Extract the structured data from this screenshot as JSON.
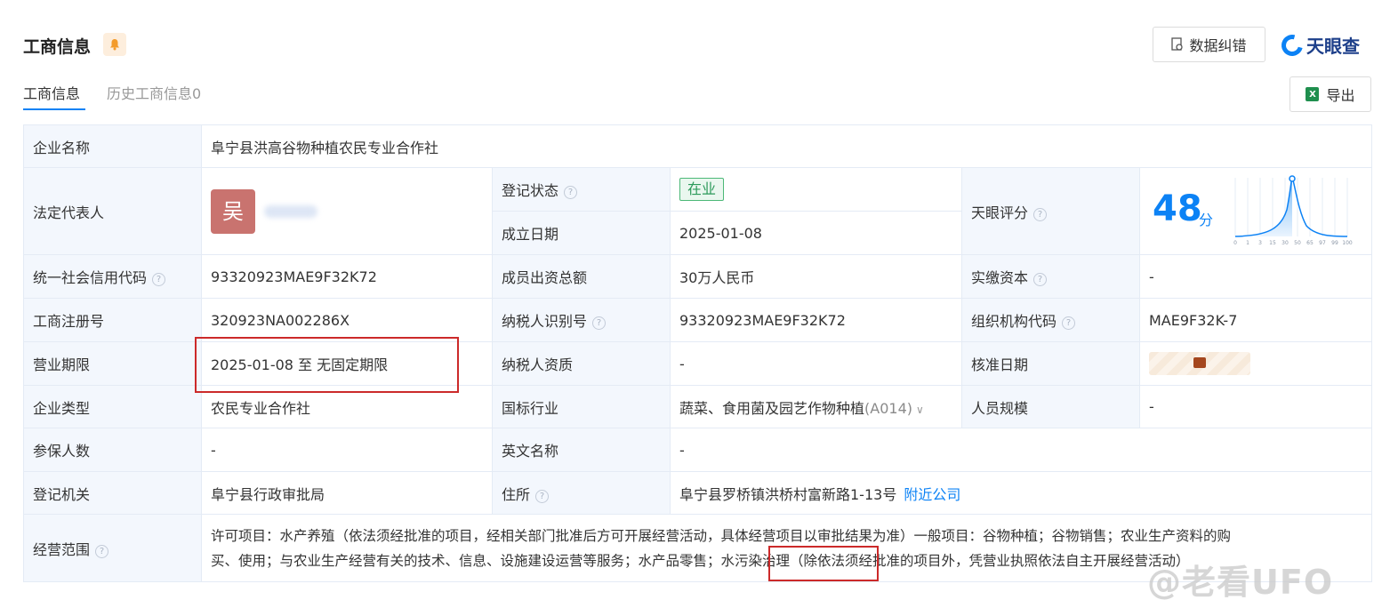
{
  "header": {
    "title": "工商信息",
    "correct_button": "数据纠错",
    "brand": "天眼查",
    "export_button": "导出"
  },
  "tabs": [
    {
      "label": "工商信息"
    },
    {
      "label": "历史工商信息0"
    }
  ],
  "rows": {
    "company_name_label": "企业名称",
    "company_name": "阜宁县洪高谷物种植农民专业合作社",
    "legal_rep_label": "法定代表人",
    "avatar_char": "吴",
    "reg_status_label": "登记状态",
    "reg_status": "在业",
    "founded_label": "成立日期",
    "founded": "2025-01-08",
    "score_label": "天眼评分",
    "score_value": 48,
    "score_unit": "分",
    "credit_code_label": "统一社会信用代码",
    "credit_code": "93320923MAE9F32K72",
    "member_capital_label": "成员出资总额",
    "member_capital": "30万人民币",
    "paid_capital_label": "实缴资本",
    "paid_capital": "-",
    "reg_no_label": "工商注册号",
    "reg_no": "320923NA002286X",
    "taxpayer_id_label": "纳税人识别号",
    "taxpayer_id": "93320923MAE9F32K72",
    "org_code_label": "组织机构代码",
    "org_code": "MAE9F32K-7",
    "term_label": "营业期限",
    "term": "2025-01-08 至 无固定期限",
    "tax_quality_label": "纳税人资质",
    "tax_quality": "-",
    "approval_date_label": "核准日期",
    "company_type_label": "企业类型",
    "company_type": "农民专业合作社",
    "industry_label": "国标行业",
    "industry": "蔬菜、食用菌及园艺作物种植",
    "industry_code": "(A014)",
    "staff_size_label": "人员规模",
    "staff_size": "-",
    "insured_label": "参保人数",
    "insured": "-",
    "english_name_label": "英文名称",
    "english_name": "-",
    "authority_label": "登记机关",
    "authority": "阜宁县行政审批局",
    "address_label": "住所",
    "address": "阜宁县罗桥镇洪桥村富新路1-13号",
    "nearby_link": "附近公司",
    "scope_label": "经营范围",
    "scope_line1": "许可项目：水产养殖（依法须经批准的项目，经相关部门批准后方可开展经营活动，具体经营项目以审批结果为准）一般项目：谷物种植；谷物销售；农业生产资料的购",
    "scope_line2": "买、使用；与农业生产经营有关的技术、信息、设施建设运营等服务；水产品零售；水污染治理（除依法须经批准的项目外，凭营业执照依法自主开展经营活动）"
  },
  "score_chart": {
    "ticks": [
      "0",
      "1",
      "3",
      "15",
      "30",
      "50",
      "65",
      "97",
      "99",
      "100"
    ]
  },
  "watermark": "@老看UFO",
  "colors": {
    "accent": "#0c82f5",
    "label_bg": "#f3f7fd",
    "status_green": "#2c9a5a",
    "highlight_red": "#cc2a2a"
  }
}
